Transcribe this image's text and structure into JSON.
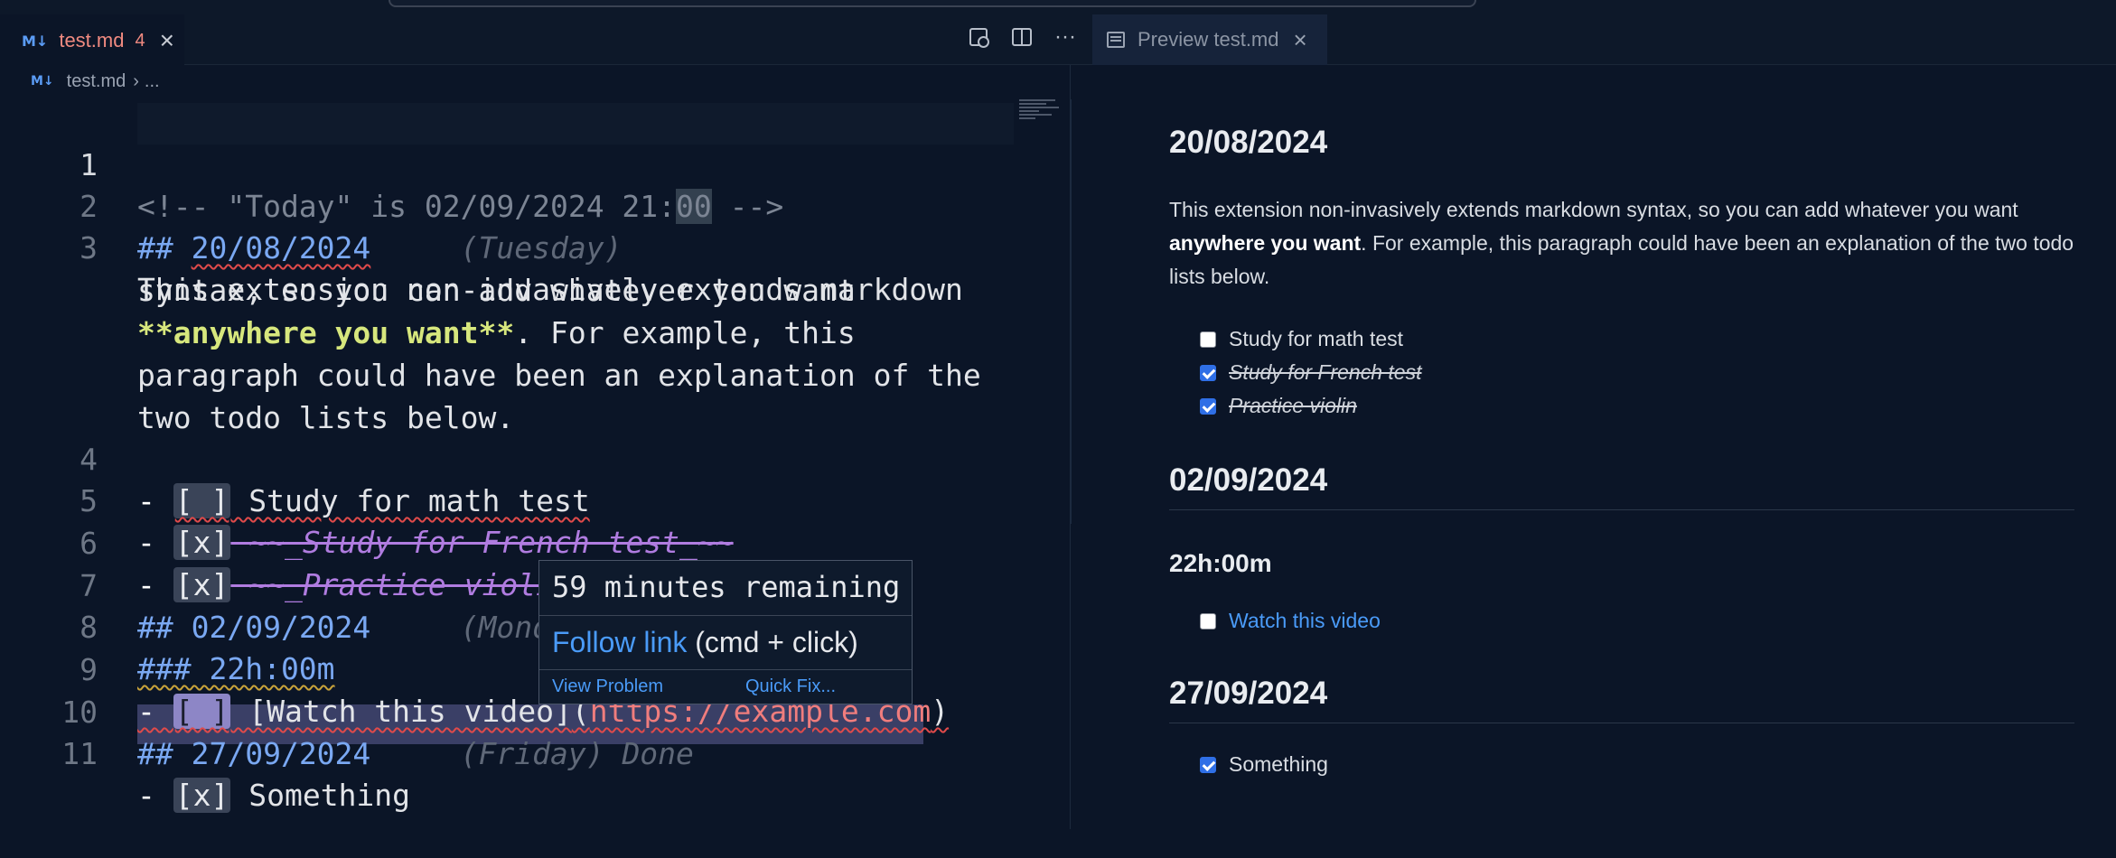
{
  "tabs": {
    "editor": {
      "name": "test.md",
      "problems": "4"
    },
    "preview": {
      "name": "Preview test.md"
    }
  },
  "breadcrumb": {
    "file": "test.md",
    "rest": "..."
  },
  "editor": {
    "line_numbers": [
      "1",
      "2",
      "3",
      "4",
      "5",
      "6",
      "7",
      "8",
      "9",
      "10",
      "11"
    ],
    "l1": {
      "part1": "<!-- \"Today\" is 02/09/2024 21:",
      "part2": "00",
      "part3": " -->"
    },
    "l2": {
      "hash": "## ",
      "date": "20/08/2024",
      "day": "     (Tuesday)"
    },
    "l3": {
      "a": "This extension non-invasively extends markdown",
      "b": "syntax, so you can add whatever you want",
      "c_mark1": "**",
      "c_bold": "anywhere you want",
      "c_mark2": "**",
      "c_rest": ". For example, this",
      "d": "paragraph could have been an explanation of the",
      "e": "two todo lists below."
    },
    "l4": {
      "dash": "- ",
      "box": "[ ]",
      "text": " Study for math test"
    },
    "l5": {
      "dash": "- ",
      "box": "[x]",
      "text": " ~~_Study for French test_~~"
    },
    "l6": {
      "dash": "- ",
      "box": "[x]",
      "text": " ~~_Practice violin_~~"
    },
    "l7": {
      "hash": "## ",
      "date": "02/09/2024",
      "day": "     (Monday)"
    },
    "l8": {
      "text": "### 22h:00m"
    },
    "l9": {
      "dash": "- ",
      "box": "[ ]",
      "link": " [Watch this video]",
      "paren1": "(",
      "url": "https://example.com",
      "paren2": ")"
    },
    "l10": {
      "hash": "## ",
      "date": "27/09/2024",
      "day": "     (Friday) Done"
    },
    "l11": {
      "dash": "- ",
      "box": "[x]",
      "text": " Something"
    }
  },
  "hover": {
    "remaining": "59 minutes remaining",
    "follow_link": "Follow link",
    "follow_hint": " (cmd + click)",
    "view_problem": "View Problem",
    "quick_fix": "Quick Fix..."
  },
  "preview": {
    "h1": "20/08/2024",
    "para_a": "This extension non-invasively extends markdown syntax, so you can add whatever you want ",
    "para_bold": "anywhere you want",
    "para_b": ". For example, this paragraph could have been an explanation of the two todo lists below.",
    "todo1": "Study for math test",
    "todo2": "Study for French test",
    "todo3": "Practice violin",
    "h2": "02/09/2024",
    "h3": "22h:00m",
    "link": "Watch this video",
    "h4": "27/09/2024",
    "todo4": "Something"
  },
  "colors": {
    "background": "#0b1527",
    "link": "#4a9bf8",
    "checkbox": "#2f6fe6",
    "error_tab": "#f08a80"
  }
}
